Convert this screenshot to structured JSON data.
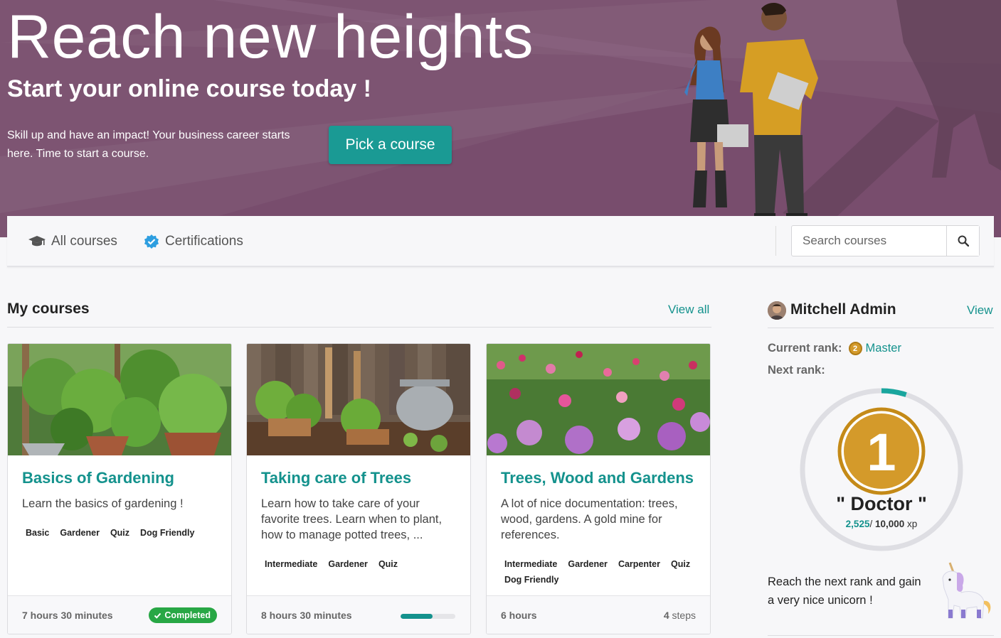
{
  "hero": {
    "title": "Reach new heights",
    "subtitle": "Start your online course today !",
    "text": "Skill up and have an impact! Your business career starts here. Time to start a course.",
    "cta_label": "Pick a course",
    "background_color": "#7d5472",
    "cta_color": "#1a9a94"
  },
  "nav": {
    "all_courses_label": "All courses",
    "all_courses_icon": "graduation-cap-icon",
    "certifications_label": "Certifications",
    "certifications_icon": "verified-check-icon",
    "search_placeholder": "Search courses",
    "search_icon": "magnifier-icon"
  },
  "my_courses": {
    "title": "My courses",
    "view_all_label": "View all",
    "accent_color": "#14928d",
    "courses": [
      {
        "title": "Basics of Gardening",
        "description": "Learn the basics of gardening !",
        "tags": [
          "Basic",
          "Gardener",
          "Quiz",
          "Dog Friendly"
        ],
        "duration": "7 hours 30 minutes",
        "status": "Completed",
        "image": "garden-plants-photo"
      },
      {
        "title": "Taking care of Trees",
        "description": "Learn how to take care of your favorite trees. Learn when to plant, how to manage potted trees, ...",
        "tags": [
          "Intermediate",
          "Gardener",
          "Quiz"
        ],
        "duration": "8 hours 30 minutes",
        "progress_percent": 58,
        "image": "garden-tools-photo"
      },
      {
        "title": "Trees, Wood and Gardens",
        "description": "A lot of nice documentation: trees, wood, gardens. A gold mine for references.",
        "tags": [
          "Intermediate",
          "Gardener",
          "Carpenter",
          "Quiz",
          "Dog Friendly"
        ],
        "duration": "6 hours",
        "steps_count": "4",
        "steps_label": "steps",
        "image": "flower-field-photo"
      }
    ]
  },
  "profile": {
    "name": "Mitchell Admin",
    "view_label": "View",
    "current_rank_label": "Current rank:",
    "current_rank": "Master",
    "current_rank_medal": "2",
    "next_rank_label": "Next rank:",
    "next_rank_number": "1",
    "next_rank_name": "\" Doctor \"",
    "xp_current": "2,525",
    "xp_separator": "/ ",
    "xp_total": "10,000",
    "xp_unit": "xp",
    "xp_progress_fraction": 0.2525,
    "reward_text": "Reach the next rank and gain a very nice unicorn !",
    "reward_icon": "unicorn-icon"
  }
}
